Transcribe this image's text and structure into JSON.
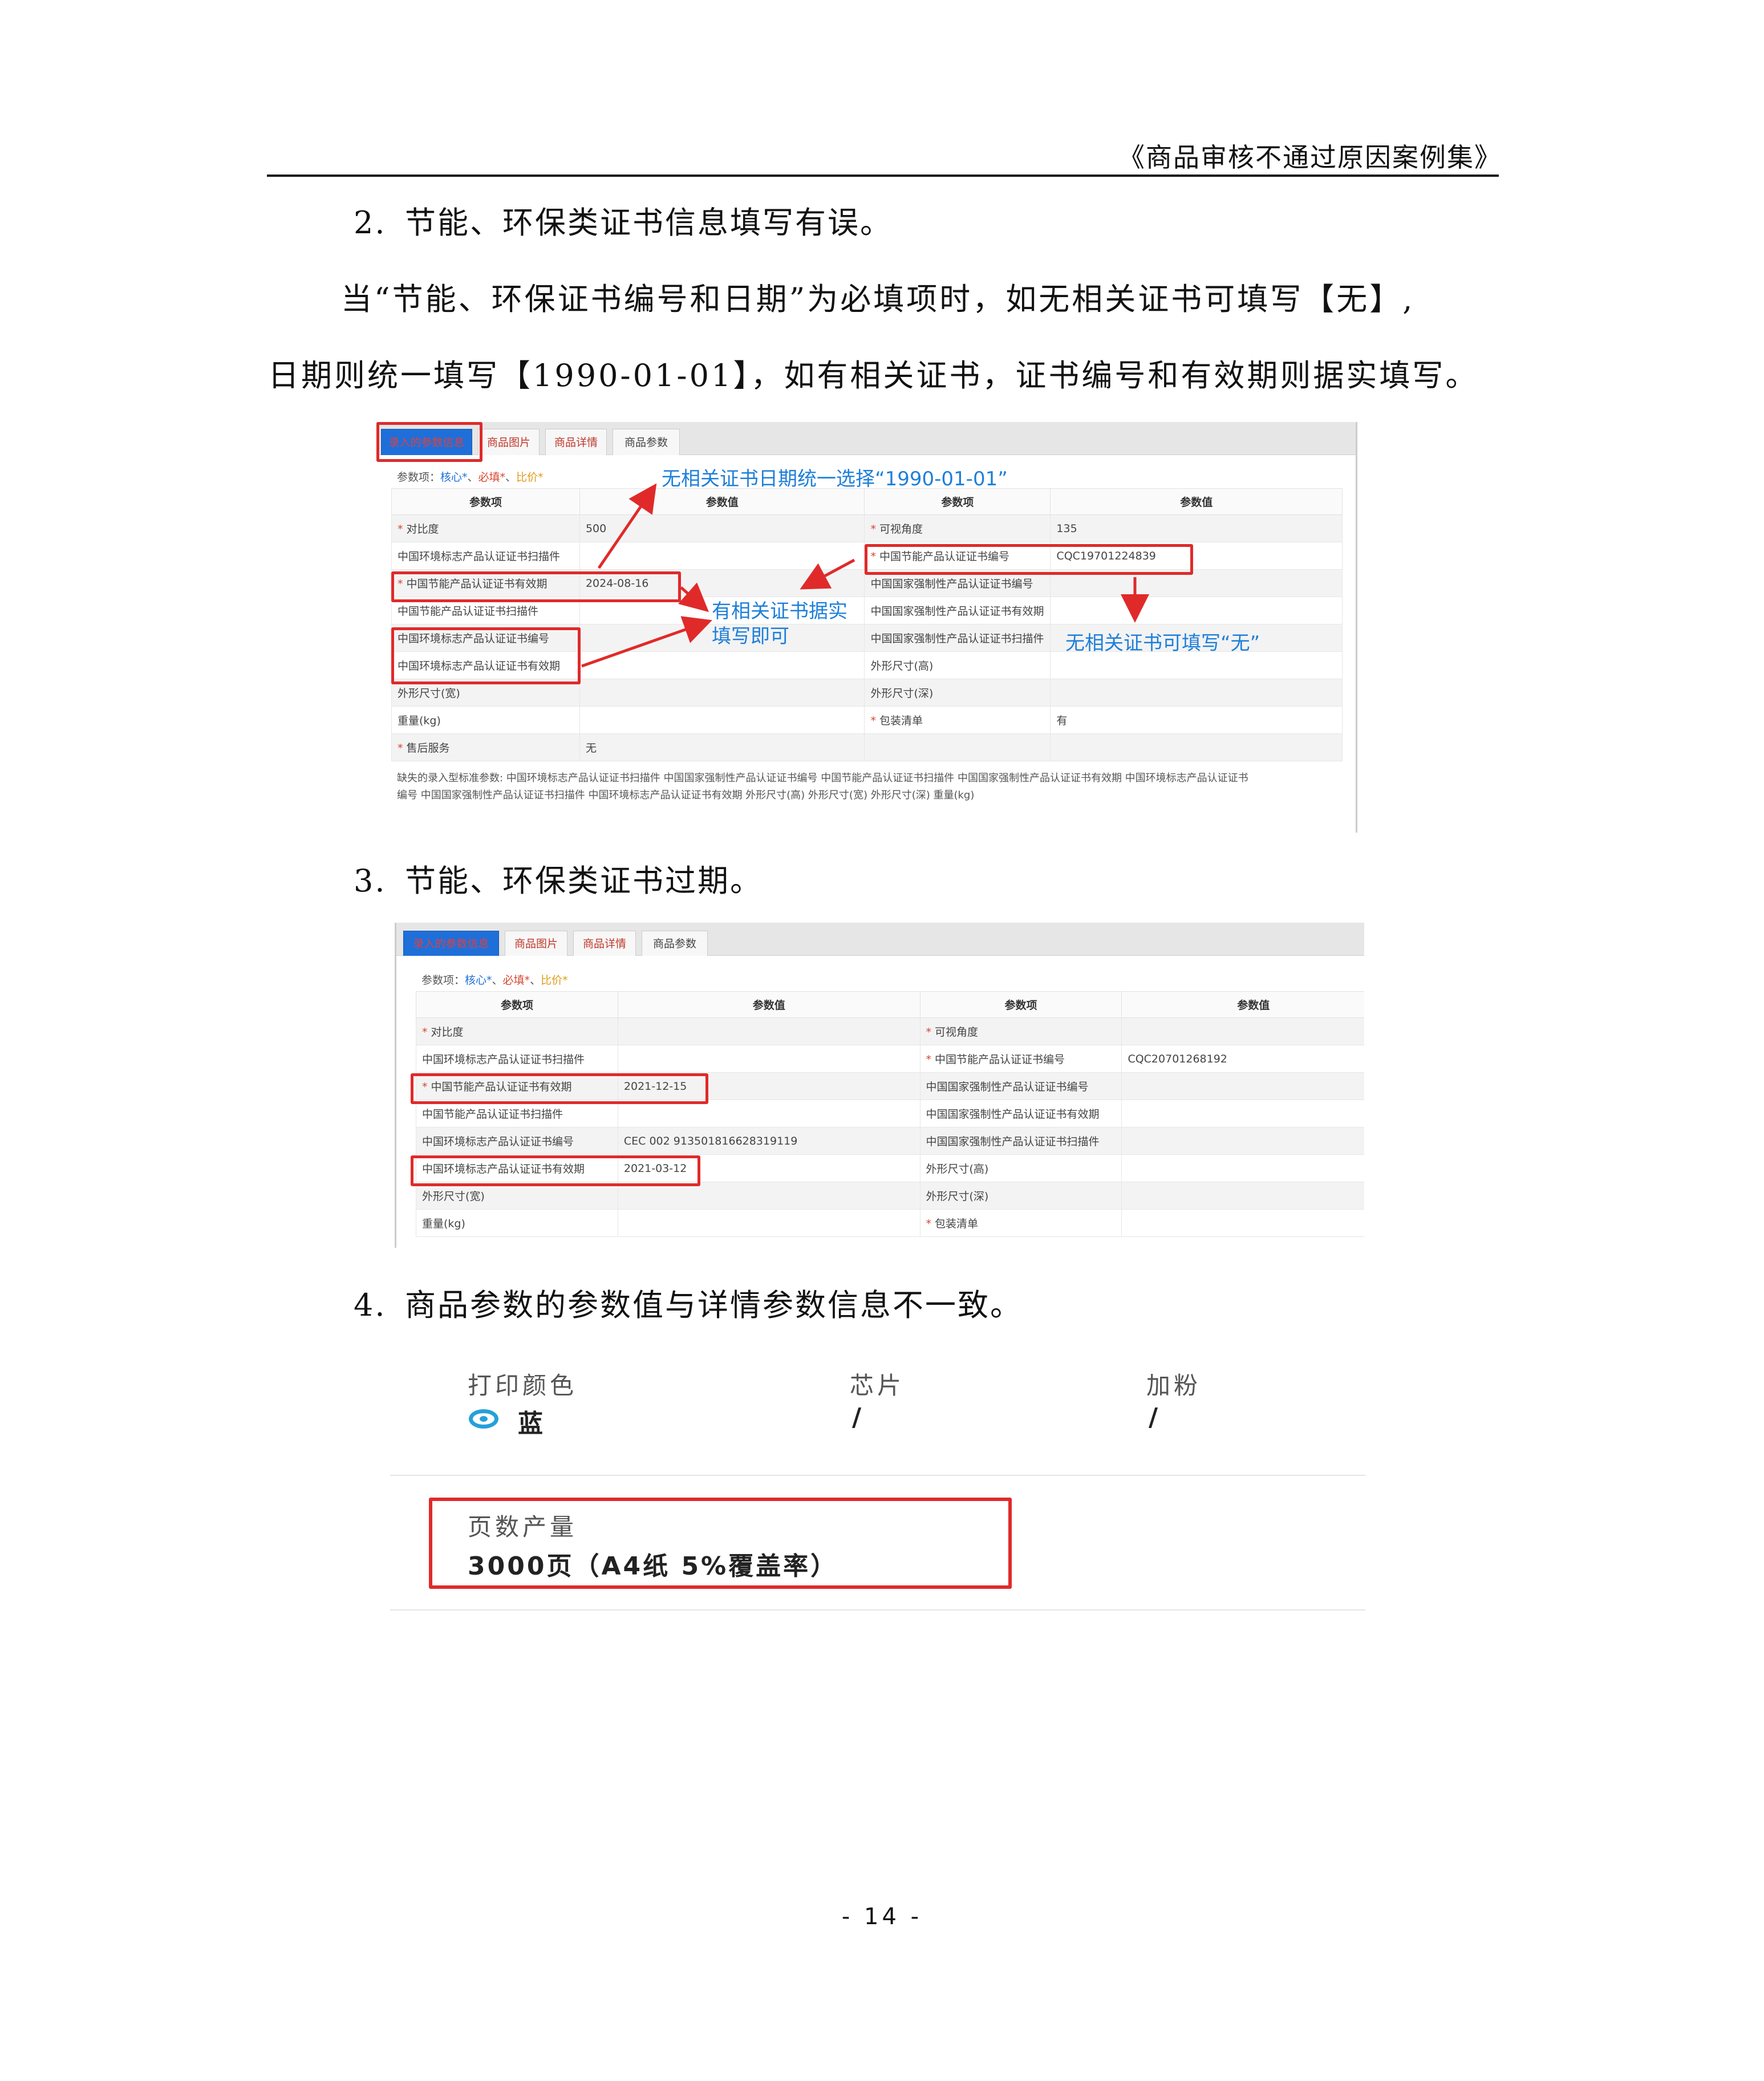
{
  "header": {
    "title": "《商品审核不通过原因案例集》"
  },
  "section2": {
    "heading_num": "2.",
    "heading_text": "节能、环保类证书信息填写有误。",
    "para_line1": "当“节能、环保证书编号和日期”为必填项时，如无相关证书可填写【无】,",
    "para_line2": "日期则统一填写【1990-01-01】，如有相关证书，证书编号和有效期则据实填写。"
  },
  "shot1": {
    "tabs": [
      "录入的参数信息",
      "商品图片",
      "商品详情",
      "商品参数"
    ],
    "legend_prefix": "参数项：",
    "legend_core": "核心*",
    "legend_sep1": "、",
    "legend_required": "必填*",
    "legend_sep2": "、",
    "legend_compare": "比价*",
    "columns": [
      "参数项",
      "参数值",
      "参数项",
      "参数值"
    ],
    "rows": [
      {
        "k1": "* 对比度",
        "v1": "500",
        "k2": "* 可视角度",
        "v2": "135"
      },
      {
        "k1": "中国环境标志产品认证证书扫描件",
        "v1": "",
        "k2": "* 中国节能产品认证证书编号",
        "v2": "CQC19701224839"
      },
      {
        "k1": "* 中国节能产品认证证书有效期",
        "v1": "2024-08-16",
        "k2": "中国国家强制性产品认证证书编号",
        "v2": ""
      },
      {
        "k1": "中国节能产品认证证书扫描件",
        "v1": "",
        "k2": "中国国家强制性产品认证证书有效期",
        "v2": ""
      },
      {
        "k1": "中国环境标志产品认证证书编号",
        "v1": "",
        "k2": "中国国家强制性产品认证证书扫描件",
        "v2": ""
      },
      {
        "k1": "中国环境标志产品认证证书有效期",
        "v1": "",
        "k2": "外形尺寸(高)",
        "v2": ""
      },
      {
        "k1": "外形尺寸(宽)",
        "v1": "",
        "k2": "外形尺寸(深)",
        "v2": ""
      },
      {
        "k1": "重量(kg)",
        "v1": "",
        "k2": "* 包装清单",
        "v2": "有"
      },
      {
        "k1": "* 售后服务",
        "v1": "无",
        "k2": "",
        "v2": ""
      }
    ],
    "missing_line1": "缺失的录入型标准参数:  中国环境标志产品认证证书扫描件  中国国家强制性产品认证证书编号  中国节能产品认证证书扫描件  中国国家强制性产品认证证书有效期  中国环境标志产品认证证书",
    "missing_line2": "编号  中国国家强制性产品认证证书扫描件  中国环境标志产品认证证书有效期  外形尺寸(高)  外形尺寸(宽)  外形尺寸(深)  重量(kg)",
    "annotations": {
      "top": "无相关证书日期统一选择“1990-01-01”",
      "middle_line1": "有相关证书据实",
      "middle_line2": "填写即可",
      "right": "无相关证书可填写“无”"
    }
  },
  "section3": {
    "heading_num": "3.",
    "heading_text": "节能、环保类证书过期。"
  },
  "shot2": {
    "tabs": [
      "录入的参数信息",
      "商品图片",
      "商品详情",
      "商品参数"
    ],
    "legend_prefix": "参数项：",
    "legend_core": "核心*",
    "legend_sep1": "、",
    "legend_required": "必填*",
    "legend_sep2": "、",
    "legend_compare": "比价*",
    "columns": [
      "参数项",
      "参数值",
      "参数项",
      "参数值"
    ],
    "rows": [
      {
        "k1": "* 对比度",
        "v1": "",
        "k2": "* 可视角度",
        "v2": ""
      },
      {
        "k1": "中国环境标志产品认证证书扫描件",
        "v1": "",
        "k2": "* 中国节能产品认证证书编号",
        "v2": "CQC20701268192"
      },
      {
        "k1": "* 中国节能产品认证证书有效期",
        "v1": "2021-12-15",
        "k2": "中国国家强制性产品认证证书编号",
        "v2": ""
      },
      {
        "k1": "中国节能产品认证证书扫描件",
        "v1": "",
        "k2": "中国国家强制性产品认证证书有效期",
        "v2": ""
      },
      {
        "k1": "中国环境标志产品认证证书编号",
        "v1": "CEC 002 913501816628319119",
        "k2": "中国国家强制性产品认证证书扫描件",
        "v2": ""
      },
      {
        "k1": "中国环境标志产品认证证书有效期",
        "v1": "2021-03-12",
        "k2": "外形尺寸(高)",
        "v2": ""
      },
      {
        "k1": "外形尺寸(宽)",
        "v1": "",
        "k2": "外形尺寸(深)",
        "v2": ""
      },
      {
        "k1": "重量(kg)",
        "v1": "",
        "k2": "* 包装清单",
        "v2": ""
      }
    ]
  },
  "section4": {
    "heading_num": "4.",
    "heading_text": "商品参数的参数值与详情参数信息不一致。",
    "spec": {
      "color_label": "打印颜色",
      "color_value": "蓝",
      "chip_label": "芯片",
      "chip_value": "/",
      "toner_label": "加粉",
      "toner_value": "/",
      "yield_label": "页数产量",
      "yield_value": "3000页（A4纸 5%覆盖率）"
    }
  },
  "footer": {
    "page_number": "- 14 -"
  },
  "colors": {
    "annotation_red": "#e02a2a",
    "annotation_blue": "#1e7fd9",
    "radio_blue": "#26a0da"
  }
}
